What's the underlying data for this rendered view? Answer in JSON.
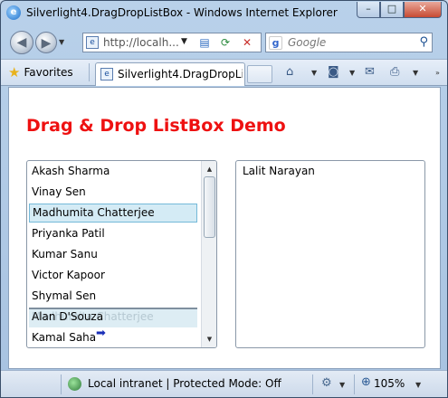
{
  "window": {
    "title": "Silverlight4.DragDropListBox - Windows Internet Explorer",
    "minimize": "–",
    "maximize": "□",
    "close": "✕"
  },
  "nav": {
    "back_glyph": "◀",
    "forward_glyph": "▶",
    "address": "http://localh...",
    "search_placeholder": "Google",
    "search_engine_glyph": "g"
  },
  "tabs": {
    "favorites_label": "Favorites",
    "active_tab_label": "Silverlight4.DragDropList..."
  },
  "commands": {
    "home": "⌂",
    "feeds": "◙",
    "mail": "✉",
    "print": "⎙"
  },
  "page": {
    "heading": "Drag & Drop ListBox Demo",
    "left_list": [
      "Akash Sharma",
      "Vinay Sen",
      "Madhumita Chatterjee",
      "Priyanka Patil",
      "Kumar Sanu",
      "Victor Kapoor",
      "Shymal Sen",
      "Alan D'Souza",
      "Kamal Saha"
    ],
    "selected_item": "Madhumita Chatterjee",
    "drag_ghost_text": "Madhumita Chatterjee",
    "right_list": [
      "Lalit Narayan"
    ]
  },
  "status": {
    "zone": "Local intranet | Protected Mode: Off",
    "zoom": "105%"
  },
  "colors": {
    "heading": "#ee1111",
    "selection": "#d4ebf5"
  }
}
